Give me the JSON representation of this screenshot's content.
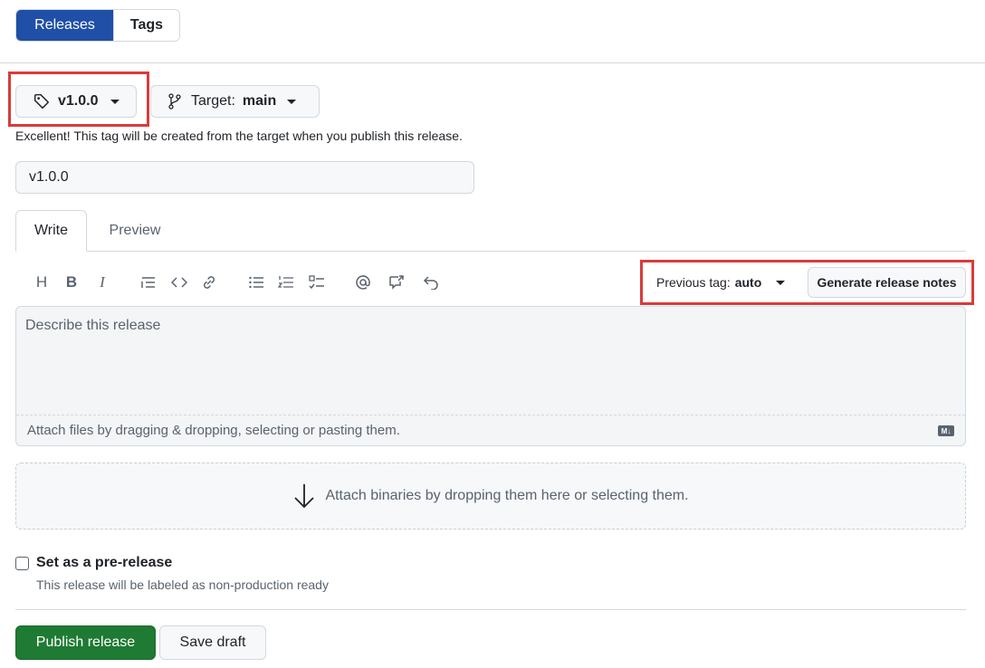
{
  "nav": {
    "releases_tab": "Releases",
    "tags_tab": "Tags"
  },
  "tag_selector": {
    "label": "v1.0.0"
  },
  "target_selector": {
    "prefix": "Target:",
    "value": "main"
  },
  "tag_hint": "Excellent! This tag will be created from the target when you publish this release.",
  "title_field": {
    "value": "v1.0.0"
  },
  "editor_tabs": {
    "write": "Write",
    "preview": "Preview"
  },
  "toolbar": {
    "icons": [
      "heading-icon",
      "bold-icon",
      "italic-icon",
      "quote-icon",
      "code-icon",
      "link-icon",
      "unordered-list-icon",
      "ordered-list-icon",
      "task-list-icon",
      "mention-icon",
      "reference-icon",
      "reply-icon"
    ],
    "heading": "H",
    "bold": "B",
    "italic": "I",
    "previous_tag_label": "Previous tag:",
    "previous_tag_value": "auto",
    "generate_notes": "Generate release notes"
  },
  "description": {
    "placeholder": "Describe this release",
    "attach_hint": "Attach files by dragging & dropping, selecting or pasting them.",
    "markdown_badge": "M↓"
  },
  "binaries": {
    "text": "Attach binaries by dropping them here or selecting them."
  },
  "prerelease": {
    "label": "Set as a pre-release",
    "help": "This release will be labeled as non-production ready",
    "checked": false
  },
  "actions": {
    "publish": "Publish release",
    "save_draft": "Save draft"
  },
  "colors": {
    "primary_blue": "#1f4fa6",
    "publish_green": "#1f7a33",
    "highlight_red": "#d93b3b"
  }
}
